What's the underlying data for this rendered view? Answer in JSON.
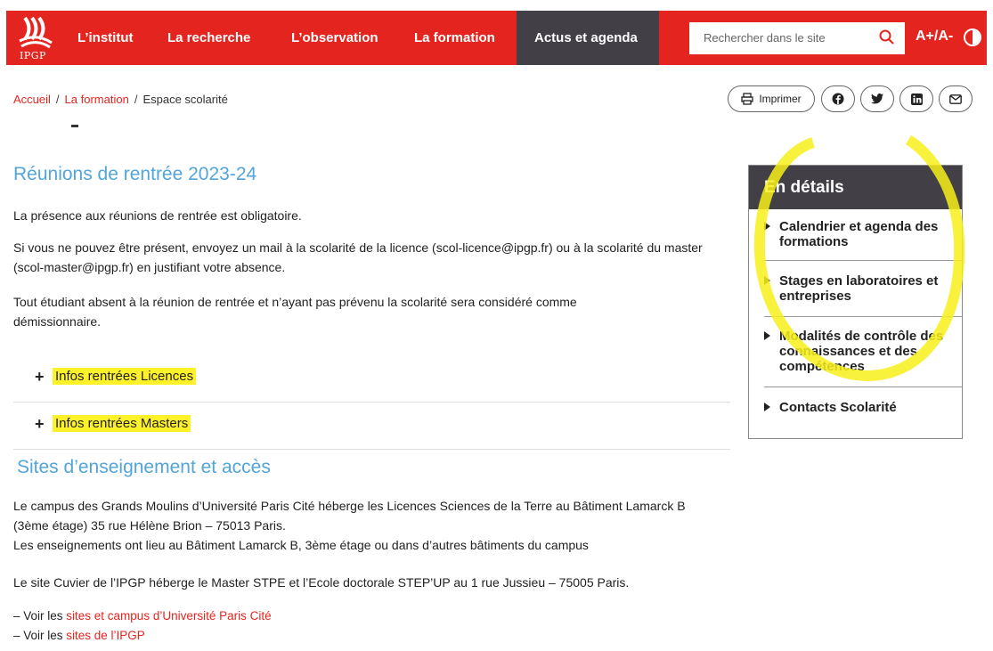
{
  "header": {
    "logo_text": "IPGP",
    "nav": [
      "L’institut",
      "La recherche",
      "L’observation",
      "La formation",
      "Actus et agenda"
    ],
    "search_placeholder": "Rechercher dans le site",
    "font_size_label": "A+/A-"
  },
  "breadcrumb": {
    "home": "Accueil",
    "section": "La formation",
    "current": "Espace scolarité"
  },
  "share": {
    "print_label": "Imprimer"
  },
  "section1": {
    "title": "Réunions de rentrée 2023-24",
    "p1": "La présence aux réunions de rentrée est obligatoire.",
    "p2": "Si vous ne pouvez être présent, envoyez un mail à la scolarité de la licence (scol-licence@ipgp.fr) ou à la scolarité du master (scol-master@ipgp.fr) en justifiant votre absence.",
    "p3": "Tout étudiant absent à la réunion de rentrée et n’ayant pas prévenu la scolarité sera considéré comme démissionnaire."
  },
  "accordion": [
    {
      "plus": "+",
      "label": "Infos rentrées Licences"
    },
    {
      "plus": "+",
      "label": "Infos rentrées Masters"
    }
  ],
  "section2": {
    "title": "Sites d’enseignement et accès",
    "p1a": "Le campus des Grands Moulins d’Université Paris Cité héberge les Licences Sciences de la Terre au Bâtiment Lamarck B (3ème étage) 35 rue Hélène Brion – 75013 Paris.",
    "p1b": "Les enseignements ont lieu au Bâtiment Lamarck B, 3ème étage ou dans d’autres bâtiments du campus",
    "p2": "Le site Cuvier de l’IPGP héberge le Master STPE et l’Ecole doctorale STEP’UP au 1 rue Jussieu – 75005 Paris.",
    "voir1_prefix": "– Voir les ",
    "voir1_link": "sites et campus d’Université Paris Cité",
    "voir2_prefix": "– Voir les ",
    "voir2_link": "sites de l’IPGP"
  },
  "sidebar": {
    "title": "En détails",
    "items": [
      "Calendrier et agenda des formations",
      "Stages en laboratoires et entreprises",
      "Modalités de contrôle des connaissances et des compétences",
      "Contacts Scolarité"
    ]
  },
  "colors": {
    "brand_red": "#e4251f",
    "dark_nav": "#423f47",
    "heading_blue": "#52a5da",
    "highlight_yellow": "#fdf22a"
  }
}
